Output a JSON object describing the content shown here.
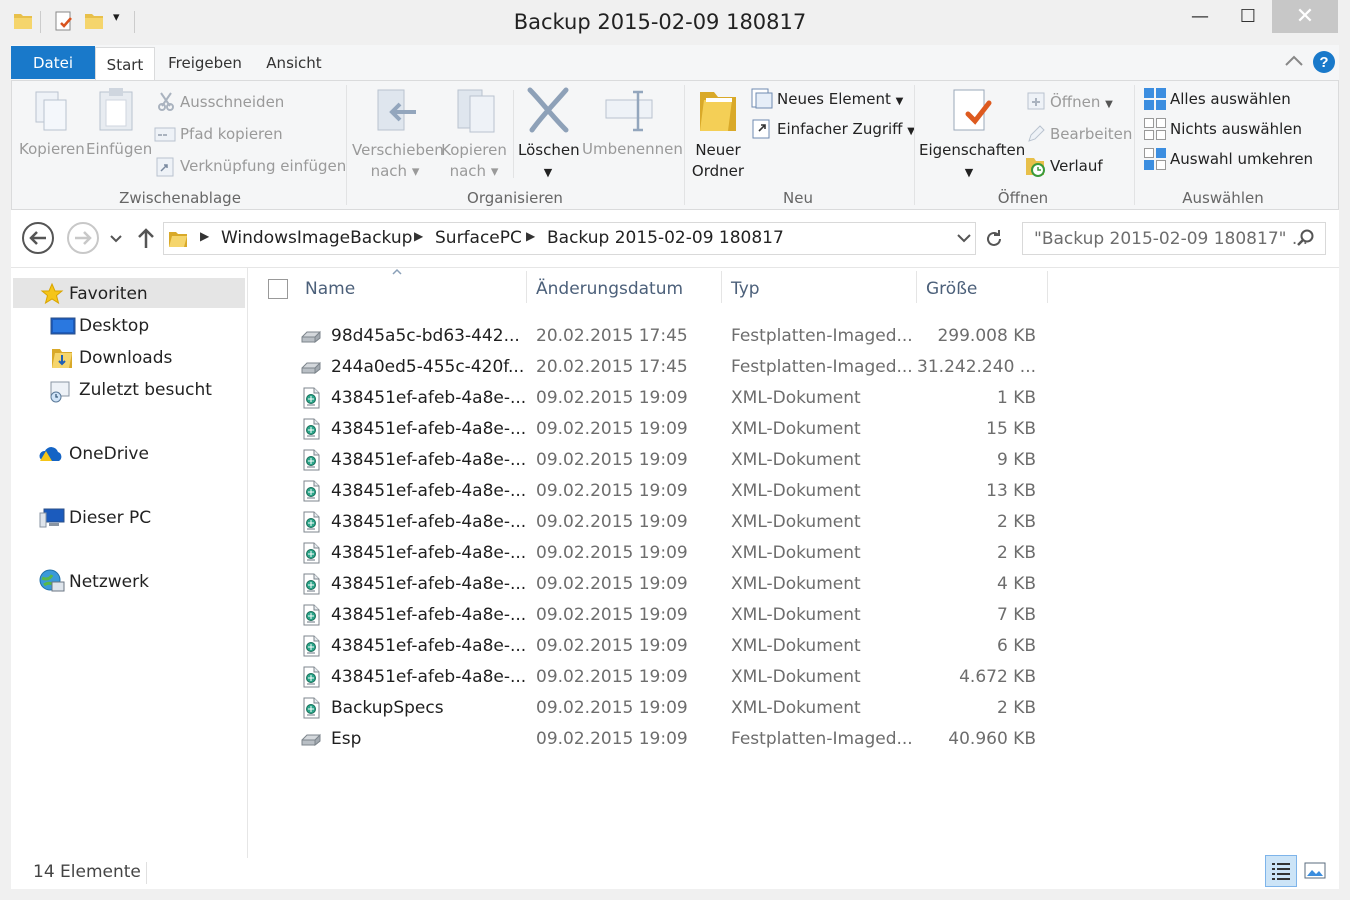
{
  "window": {
    "title": "Backup 2015-02-09 180817",
    "minimize": "—",
    "maximize": "☐",
    "close": "✕"
  },
  "qat": {
    "dropdown": "▾"
  },
  "tabs": {
    "datei": "Datei",
    "start": "Start",
    "freigeben": "Freigeben",
    "ansicht": "Ansicht"
  },
  "ribbon": {
    "clipboard": {
      "label": "Zwischenablage",
      "kopieren": "Kopieren",
      "einfuegen": "Einfügen",
      "ausschneiden": "Ausschneiden",
      "pfad": "Pfad kopieren",
      "verknuepfung": "Verknüpfung einfügen"
    },
    "organize": {
      "label": "Organisieren",
      "verschieben_1": "Verschieben",
      "verschieben_2": "nach",
      "kopieren_1": "Kopieren",
      "kopieren_2": "nach",
      "loeschen": "Löschen",
      "umbenennen": "Umbenennen"
    },
    "new": {
      "label": "Neu",
      "ordner_1": "Neuer",
      "ordner_2": "Ordner",
      "element": "Neues Element",
      "zugriff": "Einfacher Zugriff"
    },
    "open": {
      "label": "Öffnen",
      "eigenschaften": "Eigenschaften",
      "oeffnen": "Öffnen",
      "bearbeiten": "Bearbeiten",
      "verlauf": "Verlauf"
    },
    "select": {
      "label": "Auswählen",
      "alle": "Alles auswählen",
      "nichts": "Nichts auswählen",
      "umkehren": "Auswahl umkehren"
    }
  },
  "address": {
    "crumbs": [
      "WindowsImageBackup",
      "SurfacePC",
      "Backup 2015-02-09 180817"
    ],
    "search_placeholder": "\"Backup 2015-02-09 180817\" ..."
  },
  "nav": {
    "favoriten": "Favoriten",
    "desktop": "Desktop",
    "downloads": "Downloads",
    "zuletzt": "Zuletzt besucht",
    "onedrive": "OneDrive",
    "dieserpc": "Dieser PC",
    "netzwerk": "Netzwerk"
  },
  "columns": {
    "name": "Name",
    "date": "Änderungsdatum",
    "type": "Typ",
    "size": "Größe"
  },
  "files": [
    {
      "name": "98d45a5c-bd63-442...",
      "date": "20.02.2015 17:45",
      "type": "Festplatten-Imaged...",
      "size": "299.008 KB",
      "icon": "vhd"
    },
    {
      "name": "244a0ed5-455c-420f...",
      "date": "20.02.2015 17:45",
      "type": "Festplatten-Imaged...",
      "size": "31.242.240 ...",
      "icon": "vhd"
    },
    {
      "name": "438451ef-afeb-4a8e-...",
      "date": "09.02.2015 19:09",
      "type": "XML-Dokument",
      "size": "1 KB",
      "icon": "xml"
    },
    {
      "name": "438451ef-afeb-4a8e-...",
      "date": "09.02.2015 19:09",
      "type": "XML-Dokument",
      "size": "15 KB",
      "icon": "xml"
    },
    {
      "name": "438451ef-afeb-4a8e-...",
      "date": "09.02.2015 19:09",
      "type": "XML-Dokument",
      "size": "9 KB",
      "icon": "xml"
    },
    {
      "name": "438451ef-afeb-4a8e-...",
      "date": "09.02.2015 19:09",
      "type": "XML-Dokument",
      "size": "13 KB",
      "icon": "xml"
    },
    {
      "name": "438451ef-afeb-4a8e-...",
      "date": "09.02.2015 19:09",
      "type": "XML-Dokument",
      "size": "2 KB",
      "icon": "xml"
    },
    {
      "name": "438451ef-afeb-4a8e-...",
      "date": "09.02.2015 19:09",
      "type": "XML-Dokument",
      "size": "2 KB",
      "icon": "xml"
    },
    {
      "name": "438451ef-afeb-4a8e-...",
      "date": "09.02.2015 19:09",
      "type": "XML-Dokument",
      "size": "4 KB",
      "icon": "xml"
    },
    {
      "name": "438451ef-afeb-4a8e-...",
      "date": "09.02.2015 19:09",
      "type": "XML-Dokument",
      "size": "7 KB",
      "icon": "xml"
    },
    {
      "name": "438451ef-afeb-4a8e-...",
      "date": "09.02.2015 19:09",
      "type": "XML-Dokument",
      "size": "6 KB",
      "icon": "xml"
    },
    {
      "name": "438451ef-afeb-4a8e-...",
      "date": "09.02.2015 19:09",
      "type": "XML-Dokument",
      "size": "4.672 KB",
      "icon": "xml"
    },
    {
      "name": "BackupSpecs",
      "date": "09.02.2015 19:09",
      "type": "XML-Dokument",
      "size": "2 KB",
      "icon": "xml"
    },
    {
      "name": "Esp",
      "date": "09.02.2015 19:09",
      "type": "Festplatten-Imaged...",
      "size": "40.960 KB",
      "icon": "vhd"
    }
  ],
  "status": {
    "count": "14 Elemente"
  }
}
